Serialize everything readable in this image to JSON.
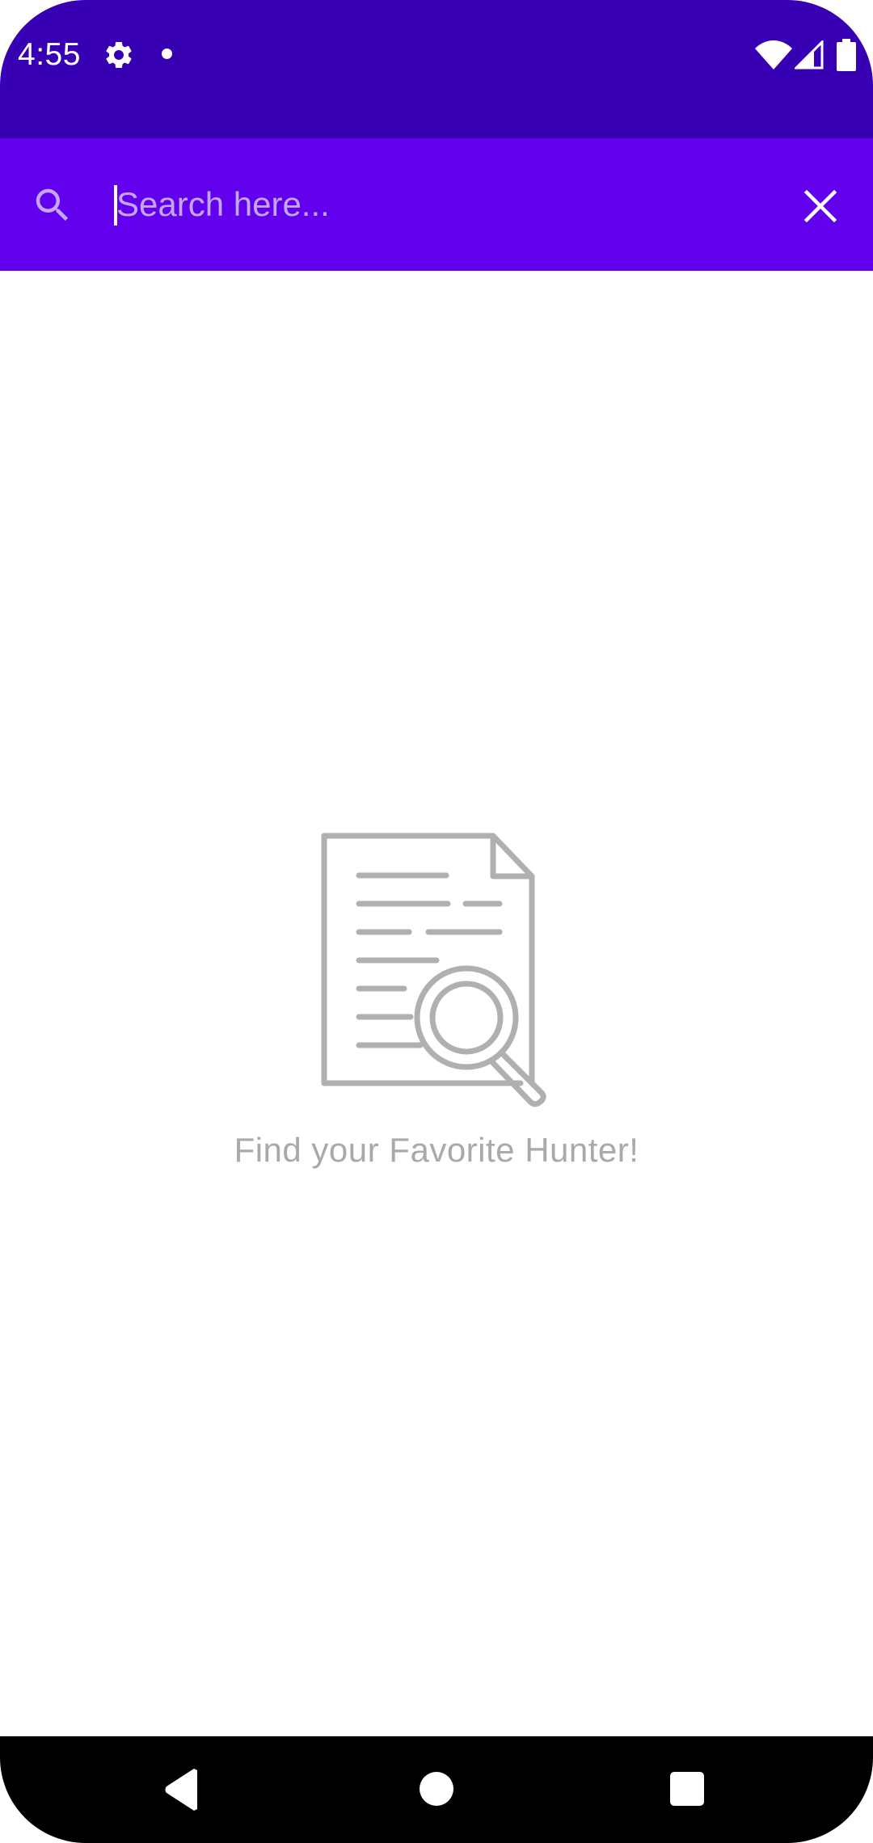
{
  "status_bar": {
    "time": "4:55",
    "icons": [
      "gear-icon",
      "notification-dot-icon",
      "wifi-icon",
      "cell-signal-icon",
      "battery-icon"
    ]
  },
  "search": {
    "placeholder": "Search here...",
    "value": "",
    "icons": [
      "search-icon",
      "close-icon"
    ]
  },
  "empty_state": {
    "message": "Find your Favorite Hunter!",
    "icon": "document-search-icon"
  },
  "nav_bar": {
    "icons": [
      "back-icon",
      "home-icon",
      "recents-icon"
    ]
  },
  "colors": {
    "status_bar": "#3700b3",
    "toolbar": "#6200ee",
    "placeholder": "#c4a6f7",
    "empty_gray": "#a9a9a9",
    "background": "#ffffff",
    "nav_bar": "#000000"
  }
}
